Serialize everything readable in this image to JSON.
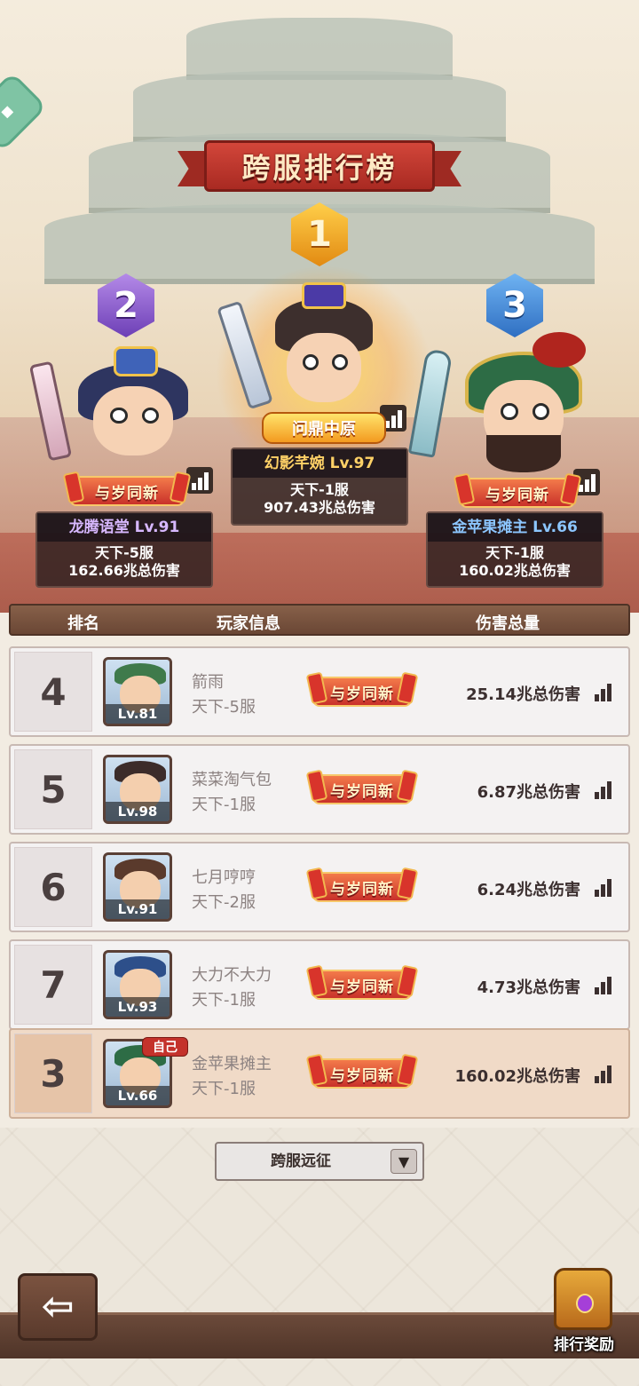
{
  "side_tab": {
    "icon": "gamepad-icon"
  },
  "header": {
    "title": "跨服排行榜"
  },
  "podium": [
    {
      "rank": "2",
      "name": "龙腾语堂 Lv.91",
      "server": "天下-5服",
      "damage": "162.66兆总伤害",
      "badge": "与岁同新",
      "color": "purple"
    },
    {
      "rank": "1",
      "name": "幻影芊婉 Lv.97",
      "server": "天下-1服",
      "damage": "907.43兆总伤害",
      "badge": "问鼎中原",
      "color": "gold"
    },
    {
      "rank": "3",
      "name": "金苹果摊主 Lv.66",
      "server": "天下-1服",
      "damage": "160.02兆总伤害",
      "badge": "与岁同新",
      "color": "blue"
    }
  ],
  "table": {
    "headers": {
      "rank": "排名",
      "player": "玩家信息",
      "damage": "伤害总量"
    },
    "rows": [
      {
        "rank": "4",
        "level": "Lv.81",
        "name": "箭雨",
        "server": "天下-5服",
        "badge": "与岁同新",
        "damage": "25.14兆总伤害"
      },
      {
        "rank": "5",
        "level": "Lv.98",
        "name": "菜菜淘气包",
        "server": "天下-1服",
        "badge": "与岁同新",
        "damage": "6.87兆总伤害"
      },
      {
        "rank": "6",
        "level": "Lv.91",
        "name": "七月哼哼",
        "server": "天下-2服",
        "badge": "与岁同新",
        "damage": "6.24兆总伤害"
      },
      {
        "rank": "7",
        "level": "Lv.93",
        "name": "大力不大力",
        "server": "天下-1服",
        "badge": "与岁同新",
        "damage": "4.73兆总伤害"
      }
    ],
    "self_row": {
      "rank": "3",
      "tag": "自己",
      "level": "Lv.66",
      "name": "金苹果摊主",
      "server": "天下-1服",
      "badge": "与岁同新",
      "damage": "160.02兆总伤害"
    }
  },
  "dropdown": {
    "selected": "跨服远征",
    "icon": "chevron-down-icon"
  },
  "footer": {
    "back_icon": "arrow-left-icon",
    "reward_label": "排行奖励",
    "reward_icon": "treasure-chest-icon"
  },
  "colors": {
    "accent_red": "#c4322b",
    "gold": "#ffd267",
    "purple": "#d7b8ff",
    "blue": "#8cc6ff"
  }
}
